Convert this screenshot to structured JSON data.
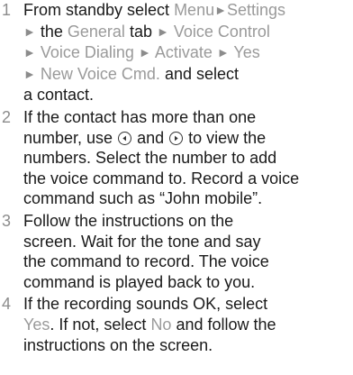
{
  "steps": [
    {
      "num": "1",
      "lines": [
        {
          "parts": [
            {
              "t": "From standby select "
            },
            {
              "t": "Menu",
              "ui": true
            },
            {
              "arrow": "►"
            },
            {
              "t": "Settings",
              "ui": true
            }
          ]
        },
        {
          "parts": [
            {
              "arrow": "►"
            },
            {
              "t": " the "
            },
            {
              "t": "General",
              "ui": true
            },
            {
              "t": " tab "
            },
            {
              "arrow": "►"
            },
            {
              "t": " "
            },
            {
              "t": "Voice Control",
              "ui": true
            }
          ]
        },
        {
          "parts": [
            {
              "arrow": "►"
            },
            {
              "t": " "
            },
            {
              "t": "Voice Dialing",
              "ui": true
            },
            {
              "t": " "
            },
            {
              "arrow": "►"
            },
            {
              "t": " "
            },
            {
              "t": "Activate",
              "ui": true
            },
            {
              "t": " "
            },
            {
              "arrow": "►"
            },
            {
              "t": " "
            },
            {
              "t": "Yes",
              "ui": true
            }
          ]
        },
        {
          "parts": [
            {
              "arrow": "►"
            },
            {
              "t": " "
            },
            {
              "t": "New Voice Cmd.",
              "ui": true
            },
            {
              "t": " and select"
            }
          ]
        },
        {
          "parts": [
            {
              "t": "a contact."
            }
          ]
        }
      ]
    },
    {
      "num": "2",
      "lines": [
        {
          "parts": [
            {
              "t": "If the contact has more than one"
            }
          ]
        },
        {
          "parts": [
            {
              "t": "number, use "
            },
            {
              "key": "navigation-left-key-icon"
            },
            {
              "t": " and "
            },
            {
              "key": "navigation-right-key-icon"
            },
            {
              "t": " to view the"
            }
          ]
        },
        {
          "parts": [
            {
              "t": "numbers. Select the number to add"
            }
          ]
        },
        {
          "parts": [
            {
              "t": "the voice command to. Record a voice"
            }
          ]
        },
        {
          "parts": [
            {
              "t": "command such as “John mobile”."
            }
          ]
        }
      ]
    },
    {
      "num": "3",
      "lines": [
        {
          "parts": [
            {
              "t": "Follow the instructions on the"
            }
          ]
        },
        {
          "parts": [
            {
              "t": "screen. Wait for the tone and say"
            }
          ]
        },
        {
          "parts": [
            {
              "t": "the command to record. The voice"
            }
          ]
        },
        {
          "parts": [
            {
              "t": "command is played back to you."
            }
          ]
        }
      ]
    },
    {
      "num": "4",
      "lines": [
        {
          "parts": [
            {
              "t": "If the recording sounds OK, select"
            }
          ]
        },
        {
          "parts": [
            {
              "t": "Yes",
              "ui": true
            },
            {
              "t": ". If not, select "
            },
            {
              "t": "No",
              "ui": true
            },
            {
              "t": " and follow the"
            }
          ]
        },
        {
          "parts": [
            {
              "t": "instructions on the screen."
            }
          ]
        }
      ]
    }
  ],
  "colors": {
    "text": "#1a1a1a",
    "ui_term": "#9a9a9a",
    "step_number": "#8c8c8c"
  }
}
